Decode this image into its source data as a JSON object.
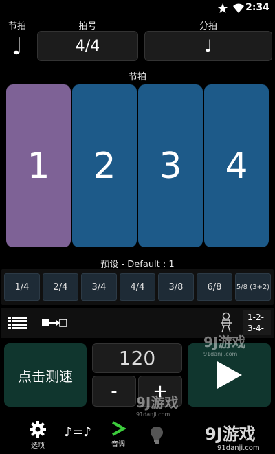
{
  "status": {
    "time": "2:34",
    "icons": [
      "star-icon",
      "wifi-icon",
      "signal-icon",
      "battery-icon"
    ]
  },
  "labels": {
    "beat": "节拍",
    "time_signature": "拍号",
    "subdivision": "分拍",
    "beats_header": "节拍"
  },
  "time_signature_value": "4/4",
  "note_glyph": "♩",
  "beats": [
    {
      "number": "1",
      "accent": true
    },
    {
      "number": "2",
      "accent": false
    },
    {
      "number": "3",
      "accent": false
    },
    {
      "number": "4",
      "accent": false
    }
  ],
  "preset_label": "预设 - Default : 1",
  "presets": [
    "1/4",
    "2/4",
    "3/4",
    "4/4",
    "3/8",
    "6/8",
    "5/8 (3+2)"
  ],
  "count_display": {
    "line1": "1-2-",
    "line2": "3-4-"
  },
  "tap_tempo_label": "点击测速",
  "tempo": "120",
  "minus_label": "-",
  "plus_label": "+",
  "bottom_nav": {
    "options_label": "选项",
    "tone_label": "音调",
    "note_equals": "♪=♪"
  },
  "watermark": {
    "brand": "游戏",
    "url": "91danji.com",
    "logo_digits": "9J"
  },
  "colors": {
    "accent_beat": "#7e6296",
    "normal_beat": "#1d5a89",
    "play_bg": "#10362e",
    "tone_green": "#3ccc3c"
  }
}
